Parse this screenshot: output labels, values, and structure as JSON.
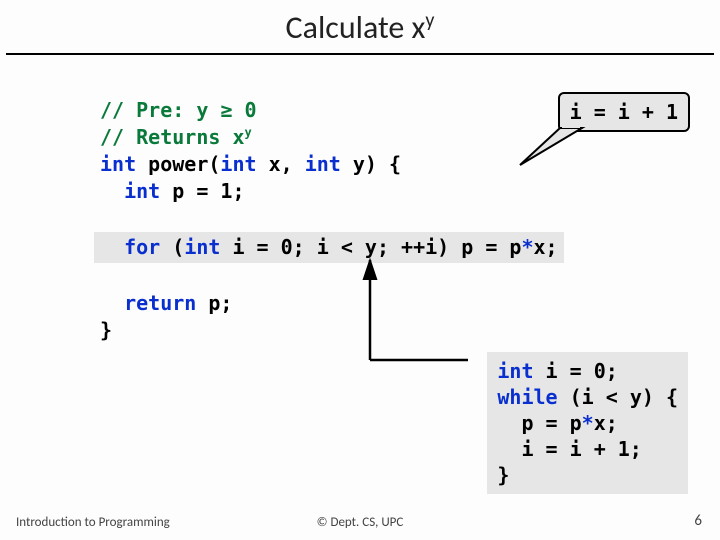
{
  "title_base": "Calculate x",
  "title_sup": "y",
  "code": {
    "c1_a": "// Pre: y ",
    "c1_b": " 0",
    "c2_a": "// Returns x",
    "c2_sup": "y",
    "sig_a": " power(",
    "sig_b": " x, ",
    "sig_c": " y) {",
    "decl_a": " p = 1;",
    "for_a": " (",
    "for_b": " i = 0; i < y; ++i) p = p",
    "for_c": "x;",
    "ret": " p;",
    "close": "}"
  },
  "kw": {
    "int": "int",
    "for": "for",
    "return": "return",
    "while": "while",
    "ge": "≥",
    "ast": "*"
  },
  "callout": "i = i + 1",
  "while_block": {
    "l1_a": " i = 0;",
    "l2_a": " (i < y) {",
    "l3": "  p = p",
    "l3b": "x;",
    "l4": "  i = i + 1;",
    "l5": "}"
  },
  "footer": {
    "left": "Introduction to Programming",
    "center": "© Dept. CS, UPC",
    "page": "6"
  }
}
